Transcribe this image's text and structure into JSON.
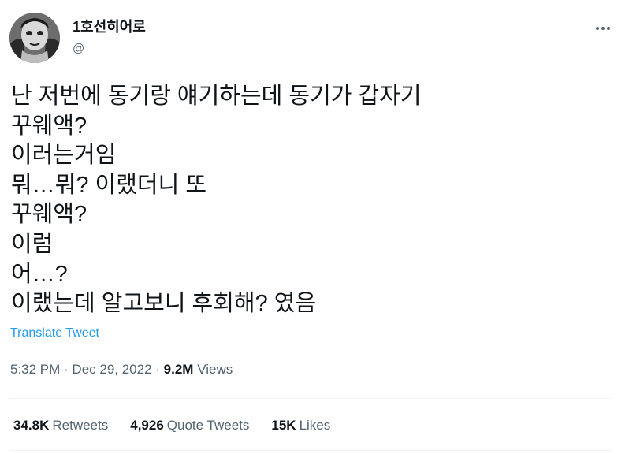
{
  "user": {
    "display_name": "1호선히어로",
    "handle": "@"
  },
  "tweet": {
    "lines": [
      "난 저번에 동기랑 얘기하는데 동기가 갑자기",
      "꾸웨액?",
      "이러는거임",
      "뭐…뭐? 이랬더니 또",
      "꾸웨액?",
      "이럼",
      "어…?",
      "이랬는데 알고보니 후회해? 였음"
    ],
    "translate_label": "Translate Tweet"
  },
  "meta": {
    "time": "5:32 PM",
    "sep1": " · ",
    "date": "Dec 29, 2022",
    "sep2": " · ",
    "views_count": "9.2M",
    "views_label": "Views"
  },
  "stats": {
    "retweets": {
      "count": "34.8K",
      "label": "Retweets"
    },
    "quote_tweets": {
      "count": "4,926",
      "label": "Quote Tweets"
    },
    "likes": {
      "count": "15K",
      "label": "Likes"
    }
  },
  "icons": {
    "more": "more-horizontal-icon"
  },
  "colors": {
    "link_blue": "#1d9bf0",
    "secondary_text": "#536471",
    "primary_text": "#0f1419",
    "divider": "#eff3f4"
  }
}
